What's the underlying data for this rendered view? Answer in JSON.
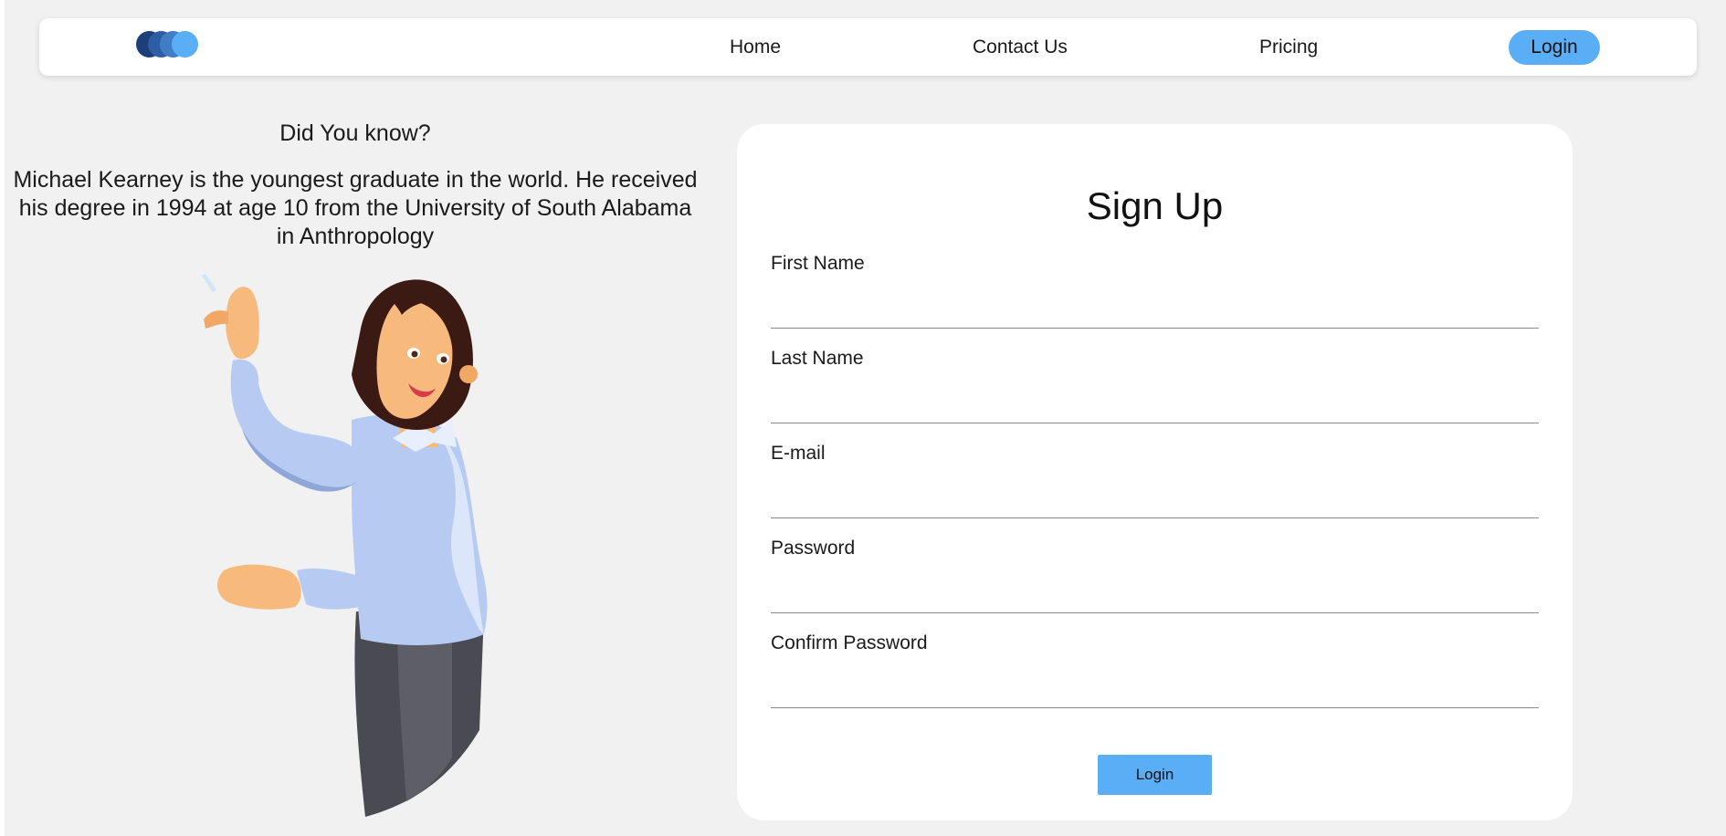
{
  "navbar": {
    "links": [
      "Home",
      "Contact Us",
      "Pricing"
    ],
    "login_label": "Login",
    "logo_colors": [
      "#1c3f7a",
      "#2d5ea3",
      "#3f7ec7",
      "#5aaef6"
    ]
  },
  "info": {
    "title": "Did You know?",
    "text": "Michael Kearney is the youngest graduate in the world. He received his degree in 1994 at age 10 from the University of South Alabama in Anthropology"
  },
  "form": {
    "title": "Sign Up",
    "fields": [
      {
        "label": "First Name",
        "value": ""
      },
      {
        "label": "Last Name",
        "value": ""
      },
      {
        "label": "E-mail",
        "value": ""
      },
      {
        "label": "Password",
        "value": ""
      },
      {
        "label": "Confirm Password",
        "value": ""
      }
    ],
    "submit_label": "Login"
  },
  "colors": {
    "accent": "#5aaef6",
    "background": "#f1f1f1",
    "card": "#ffffff"
  }
}
